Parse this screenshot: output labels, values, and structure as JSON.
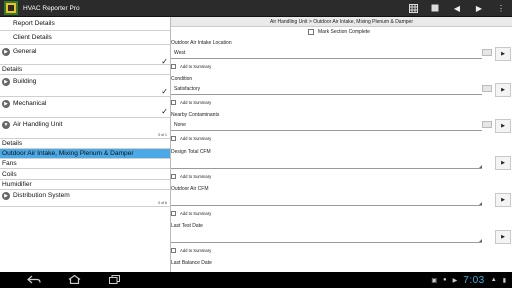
{
  "app": {
    "title": "HVAC Reporter Pro"
  },
  "actionbar": {
    "icons": [
      "grid-icon",
      "square-icon",
      "chevron-left-icon",
      "chevron-right-icon",
      "overflow-menu-icon"
    ]
  },
  "left": {
    "items": [
      {
        "label": "Report Details"
      },
      {
        "label": "Client Details"
      },
      {
        "label": "General"
      },
      {
        "label": "Details"
      },
      {
        "label": "Building"
      },
      {
        "label": "Mechanical"
      },
      {
        "label": "Air Handling Unit",
        "count": "0 of 1"
      },
      {
        "label": "Details"
      },
      {
        "label": "Outdoor Air Intake, Mixing Plenum & Damper"
      },
      {
        "label": "Fans"
      },
      {
        "label": "Coils"
      },
      {
        "label": "Humidifier"
      },
      {
        "label": "Distribution System",
        "count": "0 of 6"
      }
    ]
  },
  "right": {
    "breadcrumb": "Air Handling Unit > Outdoor Air Intake, Mixing Plenum & Damper",
    "mark_label": "Mark Section Complete",
    "fields": [
      {
        "label": "Outdoor Air Intake Location",
        "value": "West",
        "summary": "Add to Summary"
      },
      {
        "label": "Condition",
        "value": "Satisfactory",
        "summary": "Add to Summary"
      },
      {
        "label": "Nearby Contaminants",
        "value": "None",
        "summary": "Add to Summary"
      },
      {
        "label": "Design Total CFM",
        "value": "",
        "summary": "Add to Summary"
      },
      {
        "label": "Outdoor Air CFM",
        "value": "",
        "summary": "Add to Summary"
      },
      {
        "label": "Last Test Date",
        "value": "",
        "summary": "Add to Summary"
      },
      {
        "label": "Last Balance Date",
        "value": ""
      }
    ]
  },
  "statusbar": {
    "time": "7:03"
  }
}
